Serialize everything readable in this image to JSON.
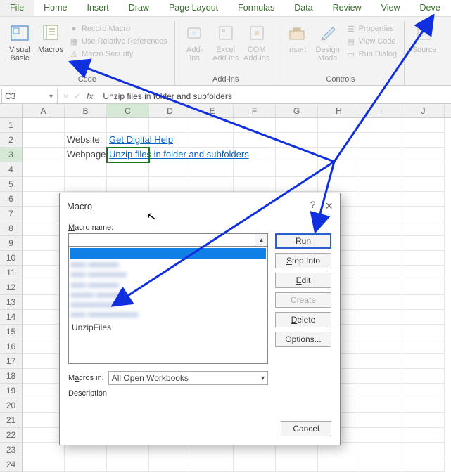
{
  "tabs": [
    "File",
    "Home",
    "Insert",
    "Draw",
    "Page Layout",
    "Formulas",
    "Data",
    "Review",
    "View",
    "Deve"
  ],
  "ribbon": {
    "code": {
      "visual_basic": "Visual\nBasic",
      "macros": "Macros",
      "record": "Record Macro",
      "relative": "Use Relative References",
      "security": "Macro Security",
      "label": "Code"
    },
    "addins": {
      "addins": "Add-\nins",
      "excel": "Excel\nAdd-ins",
      "com": "COM\nAdd-ins",
      "label": "Add-ins"
    },
    "controls": {
      "insert": "Insert",
      "design": "Design\nMode",
      "properties": "Properties",
      "viewcode": "View Code",
      "rundialog": "Run Dialog",
      "label": "Controls"
    },
    "source": {
      "source": "Source"
    }
  },
  "name_box": "C3",
  "formula": "Unzip files in folder and subfolders",
  "columns": [
    "A",
    "B",
    "C",
    "D",
    "E",
    "F",
    "G",
    "H",
    "I",
    "J"
  ],
  "cells": {
    "b2": "Website:",
    "c2": "Get Digital Help",
    "b3": "Webpage:",
    "c3": "Unzip files in folder and subfolders"
  },
  "dialog": {
    "title": "Macro",
    "help": "?",
    "close": "×",
    "macro_name_label": "Macro name:",
    "list_item": "UnzipFiles",
    "macros_in_label": "Macros in:",
    "macros_in_value": "All Open Workbooks",
    "description_label": "Description",
    "buttons": {
      "run": "Run",
      "step": "Step Into",
      "edit": "Edit",
      "create": "Create",
      "delete": "Delete",
      "options": "Options...",
      "cancel": "Cancel"
    }
  }
}
